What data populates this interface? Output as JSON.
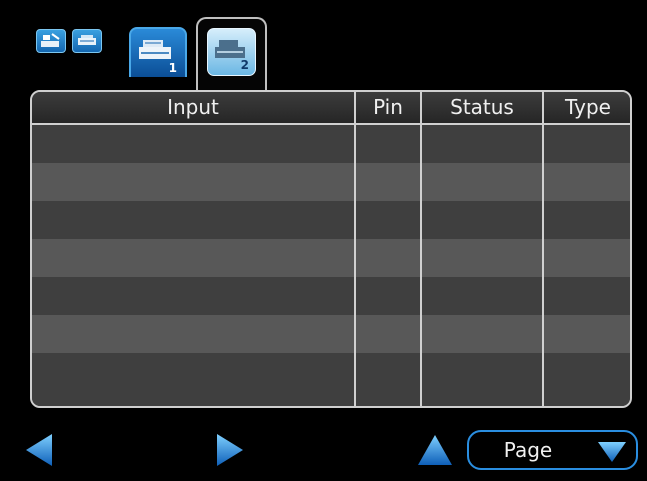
{
  "toolbar": {
    "icons": [
      "camera-stand-icon",
      "module-icon"
    ]
  },
  "tabs": [
    {
      "number": "1",
      "icon": "module-1-icon",
      "selected": false
    },
    {
      "number": "2",
      "icon": "module-2-icon",
      "selected": true
    }
  ],
  "table": {
    "headers": {
      "input": "Input",
      "pin": "Pin",
      "status": "Status",
      "type": "Type"
    },
    "row_count": 7
  },
  "nav": {
    "prev_icon": "arrow-left-icon",
    "next_icon": "arrow-right-icon",
    "page_up_icon": "arrow-up-icon",
    "page_label": "Page",
    "page_down_icon": "chevron-down-icon"
  },
  "colors": {
    "accent": "#1f7fd4",
    "row_dark": "#3f3f3f",
    "row_light": "#585858",
    "grid": "#d0d0d0"
  }
}
